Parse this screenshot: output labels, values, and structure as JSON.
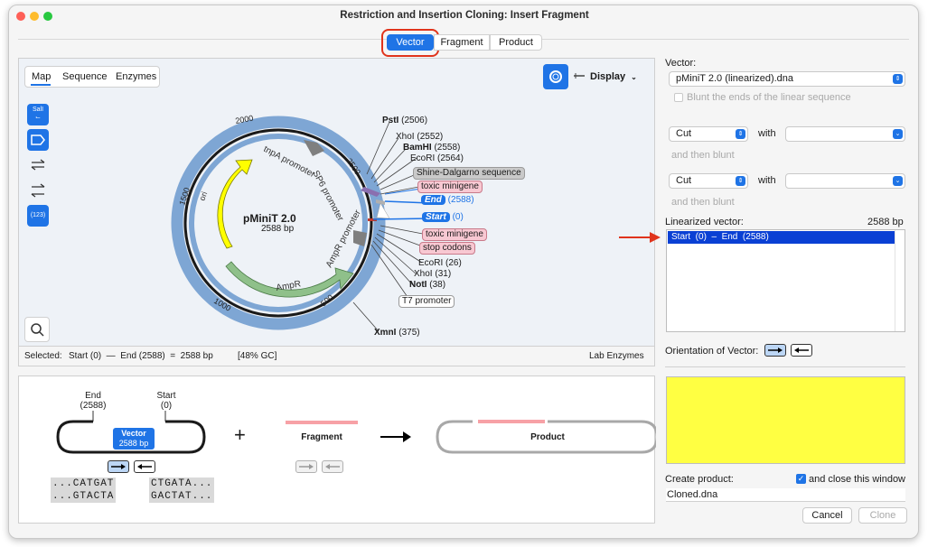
{
  "window": {
    "title": "Restriction and Insertion Cloning: Insert Fragment"
  },
  "tabs": [
    "Vector",
    "Fragment",
    "Product"
  ],
  "map_panel": {
    "view_tabs": [
      "Map",
      "Sequence",
      "Enzymes"
    ],
    "display_label": "Display",
    "tool_sall": "SalI",
    "tool_num": "(123)",
    "plasmid_name": "pMiniT 2.0",
    "plasmid_size": "2588 bp",
    "ticks": [
      "2000",
      "1500",
      "1000",
      "500",
      "2500"
    ],
    "features": [
      "tnpA promoter",
      "SP6 promoter",
      "ori",
      "AmpR promoter",
      "AmpR"
    ],
    "status": {
      "selected_label": "Selected:",
      "selected_value": "Start (0)  —  End (2588)  =  2588 bp",
      "gc": "[48% GC]",
      "enzymes": "Lab Enzymes"
    }
  },
  "map_labels": {
    "psti": "PstI",
    "psti_pos": "(2506)",
    "xhoi1": "XhoI",
    "xhoi1_pos": "(2552)",
    "bamhi": "BamHI",
    "bamhi_pos": "(2558)",
    "ecori1": "EcoRI",
    "ecori1_pos": "(2564)",
    "shine": "Shine-Dalgarno sequence",
    "toxic1": "toxic minigene",
    "end": "End",
    "end_pos": "(2588)",
    "start": "Start",
    "start_pos": "(0)",
    "toxic2": "toxic minigene",
    "stop": "stop codons",
    "ecori2": "EcoRI",
    "ecori2_pos": "(26)",
    "xhoi2": "XhoI",
    "xhoi2_pos": "(31)",
    "noti": "NotI",
    "noti_pos": "(38)",
    "t7": "T7 promoter",
    "xmni": "XmnI",
    "xmni_pos": "(375)"
  },
  "right_panel": {
    "vector_label": "Vector:",
    "vector_value": "pMiniT 2.0 (linearized).dna",
    "blunt_label": "Blunt the ends of the linear sequence",
    "cut1": "Cut",
    "with1": "with",
    "then1": "and then blunt",
    "cut2": "Cut",
    "with2": "with",
    "then2": "and then blunt",
    "linearized_label": "Linearized vector:",
    "linearized_size": "2588 bp",
    "linearized_row": "Start  (0)  –  End  (2588)",
    "orientation_label": "Orientation of Vector:",
    "create_label": "Create product:",
    "close_label": "and close this window",
    "filename": "Cloned.dna",
    "cancel": "Cancel",
    "clone": "Clone"
  },
  "diagram": {
    "end_label": "End",
    "end_pos": "(2588)",
    "start_label": "Start",
    "start_pos": "(0)",
    "vector_label": "Vector",
    "vector_size": "2588 bp",
    "plus": "+",
    "fragment_label": "Fragment",
    "product_label": "Product",
    "seq_left_top": "...CATGAT",
    "seq_left_bottom": "...GTACTA",
    "seq_right_top": "CTGATA...",
    "seq_right_bottom": "GACTAT..."
  },
  "colors": {
    "accent": "#1f74e6",
    "highlight_red": "#e0341c",
    "preview_yellow": "#ffff42",
    "ring_blue": "#7ea6d4",
    "ori_yellow": "#ffff00",
    "ampr_green": "#8fc08a"
  }
}
